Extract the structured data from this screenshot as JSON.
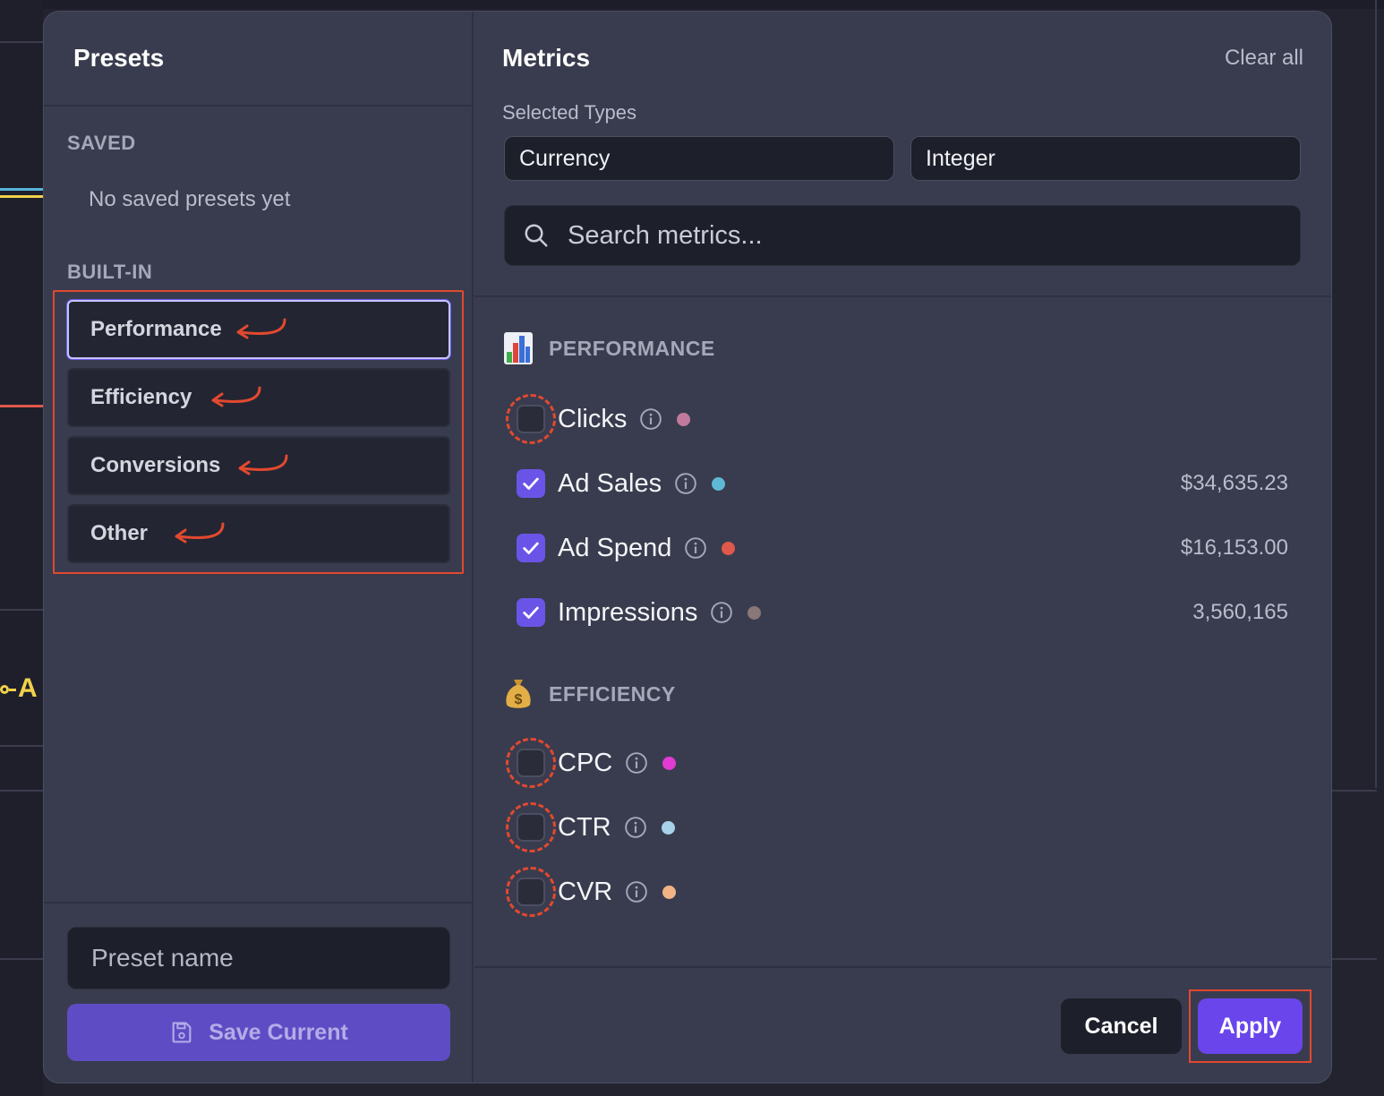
{
  "background": {
    "legend_text": "A"
  },
  "presets": {
    "title": "Presets",
    "saved_label": "SAVED",
    "saved_empty": "No saved presets yet",
    "builtin_label": "BUILT-IN",
    "builtin": [
      {
        "label": "Performance",
        "active": true
      },
      {
        "label": "Efficiency",
        "active": false
      },
      {
        "label": "Conversions",
        "active": false
      },
      {
        "label": "Other",
        "active": false
      }
    ],
    "name_placeholder": "Preset name",
    "save_label": "Save Current"
  },
  "metrics": {
    "title": "Metrics",
    "clear_all": "Clear all",
    "selected_types_label": "Selected Types",
    "selected_types": [
      "Currency",
      "Integer"
    ],
    "search_placeholder": "Search metrics...",
    "categories": [
      {
        "label": "PERFORMANCE",
        "icon": "bar-chart-icon",
        "items": [
          {
            "name": "Clicks",
            "checked": false,
            "dot_color": "#c17a9e",
            "value": ""
          },
          {
            "name": "Ad Sales",
            "checked": true,
            "dot_color": "#5fb8d6",
            "value": "$34,635.23"
          },
          {
            "name": "Ad Spend",
            "checked": true,
            "dot_color": "#e0584a",
            "value": "$16,153.00"
          },
          {
            "name": "Impressions",
            "checked": true,
            "dot_color": "#8a7778",
            "value": "3,560,165"
          }
        ]
      },
      {
        "label": "EFFICIENCY",
        "icon": "money-bag-icon",
        "items": [
          {
            "name": "CPC",
            "checked": false,
            "dot_color": "#e23ad2",
            "value": ""
          },
          {
            "name": "CTR",
            "checked": false,
            "dot_color": "#a8d2ea",
            "value": ""
          },
          {
            "name": "CVR",
            "checked": false,
            "dot_color": "#f2b387",
            "value": ""
          }
        ]
      }
    ]
  },
  "actions": {
    "cancel": "Cancel",
    "apply": "Apply"
  },
  "colors": {
    "accent": "#6a45ec",
    "annotation": "#e2492f"
  }
}
